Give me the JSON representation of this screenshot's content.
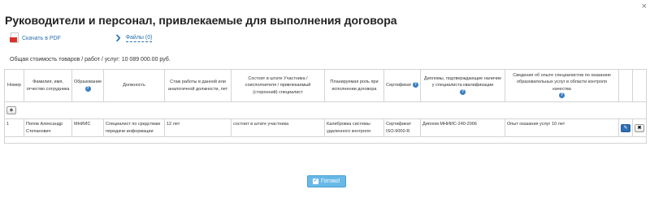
{
  "dialog": {
    "title": "Руководители и персонал, привлекаемые для выполнения договора",
    "close_glyph": "×"
  },
  "actions": {
    "pdf_label": "Скачать в PDF",
    "files_label": "Файлы (0)",
    "chevron_glyph": "❯"
  },
  "total_cost": "Общая стоимость товаров / работ / услуг: 10 089 000.00 руб.",
  "table": {
    "headers": [
      "Номер",
      "Фамилия, имя, отчество сотрудника",
      "Образование",
      "Должность",
      "Стаж работы в данной или аналогичной должности, лет",
      "Состоит в штате Участника / соисполнителя / привлекаемый (сторонний) специалист",
      "Планируемая роль при исполнении договора",
      "Сертификат",
      "Дипломы, подтверждающие наличие у специалиста квалификации",
      "Сведения об опыте специалистов по оказанию образовательных услуг в области контроля качества"
    ],
    "add_glyph": "+",
    "rows": [
      {
        "num": "1",
        "name": "Попов Александр Степанович",
        "education": "МНИИС",
        "position": "Специалист по средствам передачи информации",
        "experience": "12 лет",
        "staff": "состоит в штате участника",
        "role": "Калибровка системы удаленного контроля",
        "certificate": "Сертификат ISO-9000-R",
        "diplomas": "Диплом МНИИС-240-2006",
        "qa_experience": "Опыт оказания услуг 10 лет"
      }
    ]
  },
  "icons": {
    "info": "?",
    "edit": "✎",
    "delete": "✖",
    "check": "✓"
  },
  "done_label": "Готово!",
  "colors": {
    "link": "#2b6fae",
    "info_icon": "#3a7fc1",
    "pdf_badge": "#d9322b",
    "edit_button": "#2f6fb3",
    "done_button": "#68b9e8"
  }
}
